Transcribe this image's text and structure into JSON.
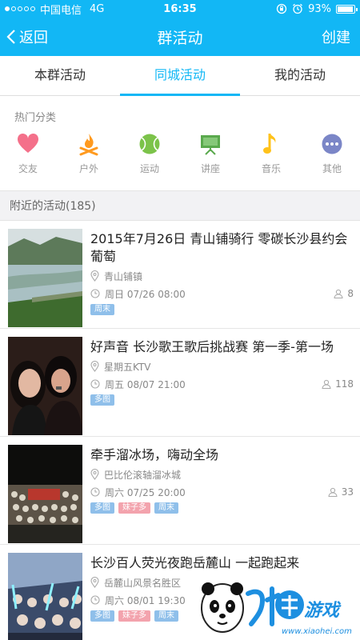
{
  "status_bar": {
    "carrier": "中国电信",
    "network": "4G",
    "time": "16:35",
    "battery": "93%",
    "battery_level": 0.93
  },
  "header": {
    "back_label": "返回",
    "title": "群活动",
    "create_label": "创建"
  },
  "tabs": [
    {
      "label": "本群活动",
      "active": false
    },
    {
      "label": "同城活动",
      "active": true
    },
    {
      "label": "我的活动",
      "active": false
    }
  ],
  "hot_categories_label": "热门分类",
  "categories": [
    {
      "label": "交友",
      "icon": "heart-icon",
      "color": "#f4708a"
    },
    {
      "label": "户外",
      "icon": "campfire-icon",
      "color": "#ff9a1f"
    },
    {
      "label": "运动",
      "icon": "tennis-ball-icon",
      "color": "#7cc34a"
    },
    {
      "label": "讲座",
      "icon": "presentation-board-icon",
      "color": "#5aa94d"
    },
    {
      "label": "音乐",
      "icon": "music-note-icon",
      "color": "#ffc21a"
    },
    {
      "label": "其他",
      "icon": "more-dots-icon",
      "color": "#7b86c7"
    }
  ],
  "nearby_label": "附近的活动(185)",
  "events": [
    {
      "title": "2015年7月26日 青山铺骑行 零碳长沙县约会葡萄",
      "location": "青山铺镇",
      "time": "周日 07/26 08:00",
      "count": "8",
      "tags": [
        "周末"
      ]
    },
    {
      "title": "好声音 长沙歌王歌后挑战赛 第一季-第一场",
      "location": "星期五KTV",
      "time": "周五 08/07 21:00",
      "count": "118",
      "tags": [
        "多图"
      ]
    },
    {
      "title": "牵手溜冰场，嗨动全场",
      "location": "巴比伦滚轴溜冰城",
      "time": "周六 07/25 20:00",
      "count": "33",
      "tags": [
        "多图",
        "妹子多",
        "周末"
      ]
    },
    {
      "title": "长沙百人荧光夜跑岳麓山 一起跑起来",
      "location": "岳麓山风景名胜区",
      "time": "周六 08/01 19:30",
      "count": "",
      "tags": [
        "多图",
        "妹子多",
        "周末"
      ]
    }
  ],
  "watermark": {
    "text": "小黑游戏",
    "url": "www.xiaohei.com"
  }
}
